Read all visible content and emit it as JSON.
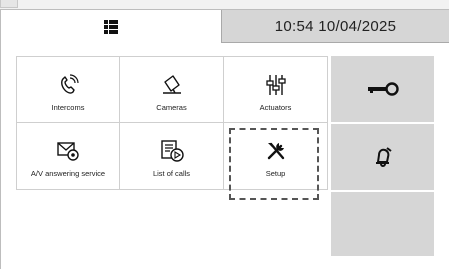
{
  "header": {
    "menu_icon": "grid-menu-icon",
    "datetime": "10:54 10/04/2025"
  },
  "tiles": [
    {
      "label": "Intercoms",
      "icon": "intercom-handset-icon"
    },
    {
      "label": "Cameras",
      "icon": "camera-icon"
    },
    {
      "label": "Actuators",
      "icon": "actuators-icon"
    },
    {
      "label": "A/V answering service",
      "icon": "answering-service-icon"
    },
    {
      "label": "List of calls",
      "icon": "call-list-icon"
    },
    {
      "label": "Setup",
      "icon": "tools-icon"
    }
  ],
  "side_buttons": [
    {
      "icon": "key-icon"
    },
    {
      "icon": "bell-muted-icon"
    },
    {
      "icon": ""
    }
  ],
  "colors": {
    "panel_gray": "#d6d6d6",
    "header_gray": "#d6d6d6",
    "icon": "#111111"
  }
}
